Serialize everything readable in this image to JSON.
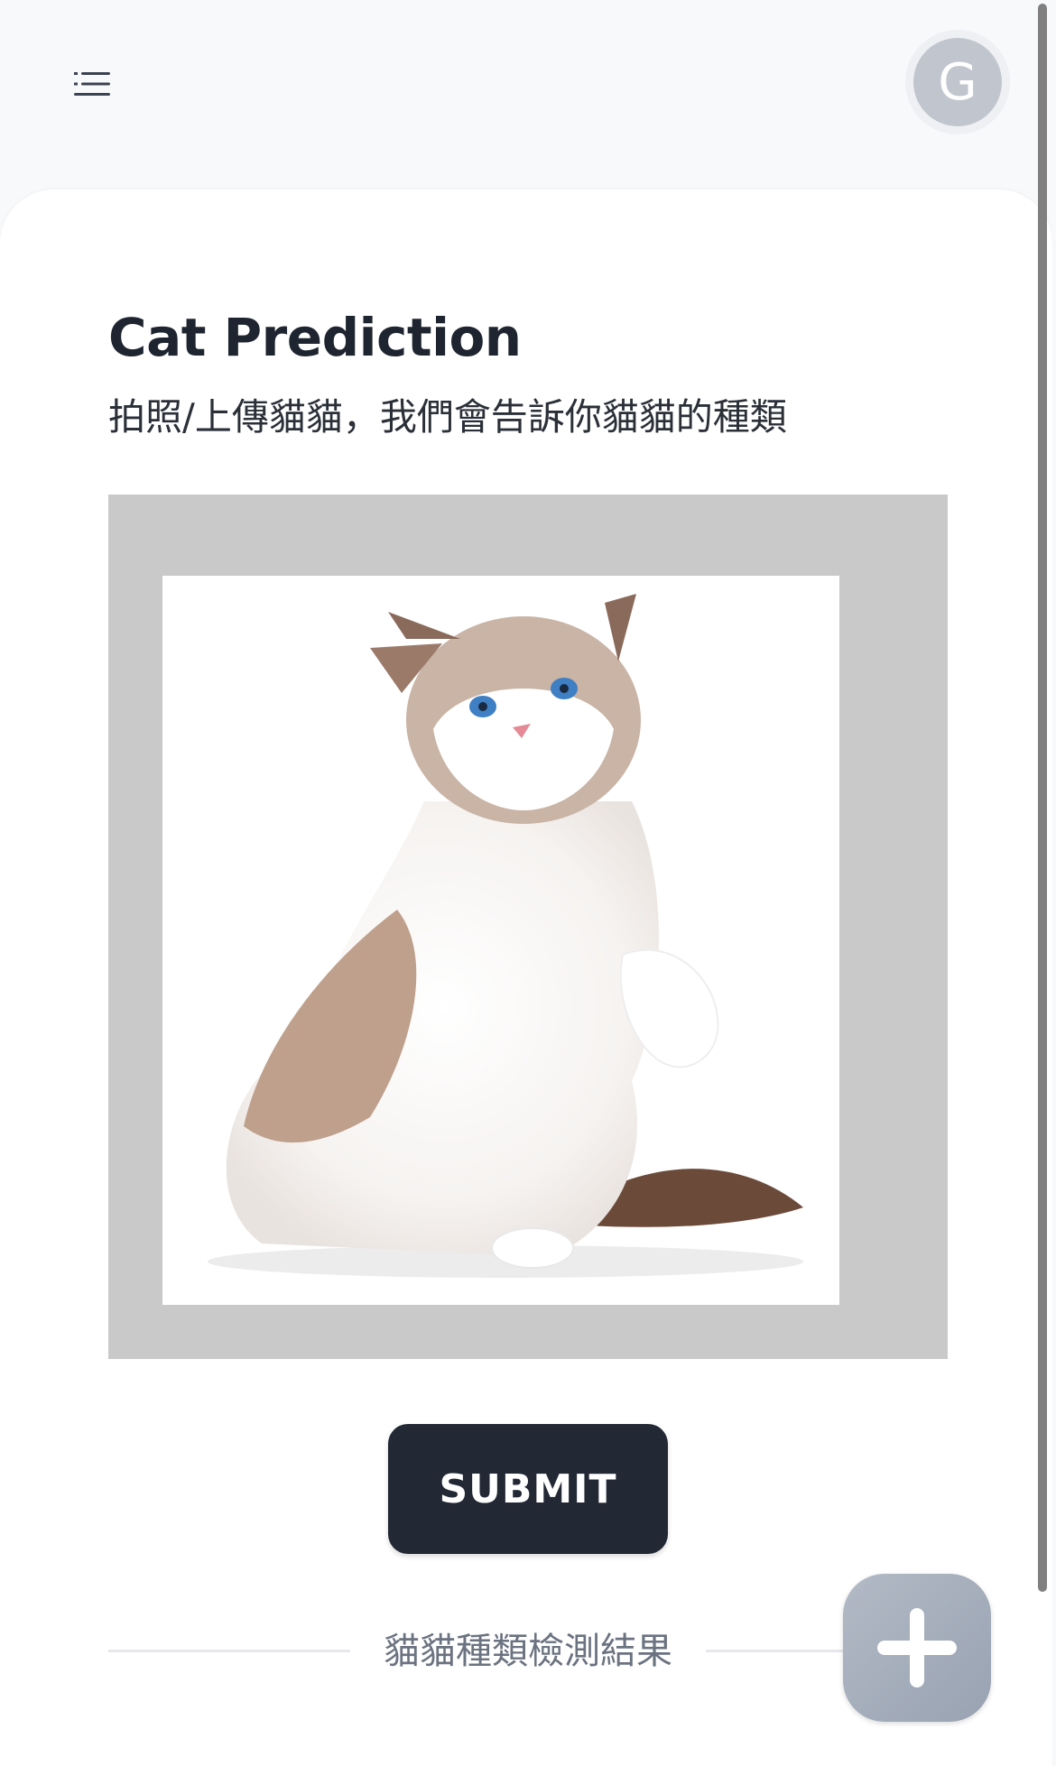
{
  "header": {
    "menu_icon": "menu-list-icon",
    "avatar_initial": "G"
  },
  "main": {
    "title": "Cat Prediction",
    "subtitle": "拍照/上傳貓貓，我們會告訴你貓貓的種類",
    "preview_image": "ragdoll-cat-photo",
    "submit_label": "SUBMIT",
    "result_divider_label": "貓貓種類檢測結果"
  },
  "fab": {
    "icon": "plus-icon"
  },
  "colors": {
    "background": "#f8f9fb",
    "card": "#ffffff",
    "title_text": "#1f2530",
    "submit_button": "#222834",
    "upload_frame": "#c9c9c9",
    "avatar": "#c1c6ce",
    "fab": "#a3abb8"
  }
}
